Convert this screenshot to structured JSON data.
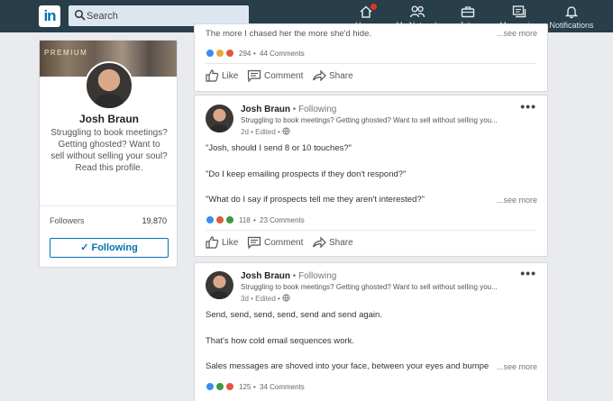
{
  "nav": {
    "logo": "in",
    "search_placeholder": "Search",
    "items": [
      {
        "label": "Home"
      },
      {
        "label": "My Network"
      },
      {
        "label": "Jobs"
      },
      {
        "label": "Messaging"
      },
      {
        "label": "Notifications"
      }
    ]
  },
  "profile": {
    "premium_label": "PREMIUM",
    "name": "Josh Braun",
    "headline": "Struggling to book meetings? Getting ghosted? Want to sell without selling your soul? Read this profile.",
    "followers_label": "Followers",
    "followers_count": "19,870",
    "follow_button": "Following"
  },
  "posts": [
    {
      "text_lines": [
        "The more I chased her the more she'd hide."
      ],
      "see_more": "...see more",
      "reaction_count": "294",
      "comments": "44 Comments",
      "actions": {
        "like": "Like",
        "comment": "Comment",
        "share": "Share"
      }
    },
    {
      "author": "Josh Braun",
      "follow_status": "Following",
      "headline": "Struggling to book meetings? Getting ghosted? Want to sell without selling you...",
      "meta": "2d • Edited •",
      "text_lines": [
        "\"Josh, should I send 8 or 10 touches?\"",
        "\"Do I keep emailing prospects if they don't respond?\"",
        "\"What do I say if prospects tell me they aren't interested?\""
      ],
      "see_more": "...see more",
      "reaction_count": "118",
      "comments": "23 Comments",
      "actions": {
        "like": "Like",
        "comment": "Comment",
        "share": "Share"
      }
    },
    {
      "author": "Josh Braun",
      "follow_status": "Following",
      "headline": "Struggling to book meetings? Getting ghosted? Want to sell without selling you...",
      "meta": "3d • Edited •",
      "text_lines": [
        "Send, send, send, send, send and send again.",
        "That's how cold email sequences work.",
        "Sales messages are shoved into your face, between your eyes and bumpe"
      ],
      "see_more": "...see more",
      "reaction_count": "125",
      "comments": "34 Comments"
    }
  ],
  "colors": {
    "nav_bg": "#283e4a",
    "brand_blue": "#0073b1",
    "like_blue": "#378fe9",
    "love_red": "#e0573c",
    "celebrate_green": "#3d9a3e",
    "insight_yellow": "#e9a83f"
  }
}
